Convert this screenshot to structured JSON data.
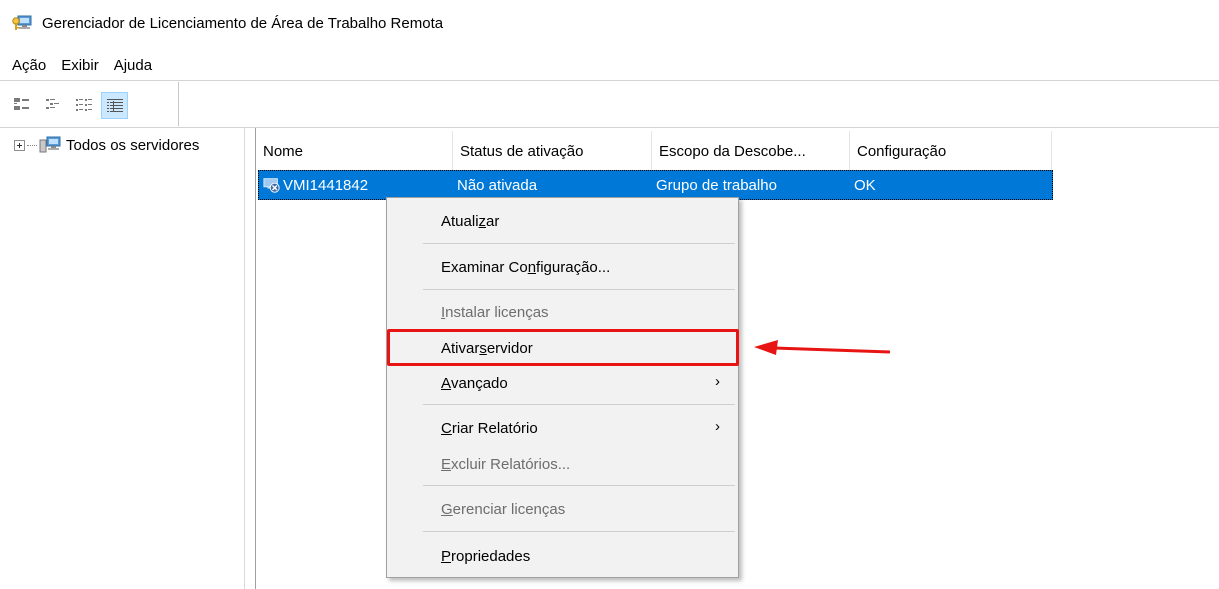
{
  "window": {
    "title": "Gerenciador de Licenciamento de Área de Trabalho Remota",
    "icon": "rd-licensing-icon"
  },
  "menubar": {
    "items": [
      "Ação",
      "Exibir",
      "Ajuda"
    ]
  },
  "toolbar": {
    "buttons": [
      "large-icons-icon",
      "small-icons-icon",
      "list-view-icon",
      "details-view-icon"
    ],
    "active": "details-view-icon"
  },
  "tree": {
    "root_label": "Todos os servidores"
  },
  "list": {
    "columns": [
      "Nome",
      "Status de ativação",
      "Escopo da Descobe...",
      "Configuração"
    ],
    "rows": [
      {
        "name": "VMI1441842",
        "status": "Não ativada",
        "scope": "Grupo de trabalho",
        "config": "OK"
      }
    ]
  },
  "context_menu": {
    "refresh": {
      "pre": "Atuali",
      "key": "z",
      "post": "ar"
    },
    "review": {
      "pre": "Examinar Co",
      "key": "n",
      "post": "figuração..."
    },
    "install": {
      "pre": "",
      "key": "I",
      "post": "nstalar licenças"
    },
    "activate": {
      "pre": "Ativar ",
      "key": "s",
      "post": "ervidor"
    },
    "advanced": {
      "pre": "",
      "key": "A",
      "post": "vançado"
    },
    "create_report": {
      "pre": "",
      "key": "C",
      "post": "riar Relatório"
    },
    "delete_reports": {
      "pre": "",
      "key": "E",
      "post": "xcluir Relatórios..."
    },
    "manage": {
      "pre": "",
      "key": "G",
      "post": "erenciar licenças"
    },
    "properties": {
      "pre": "",
      "key": "P",
      "post": "ropriedades"
    },
    "submenu_arrow": "›"
  },
  "colors": {
    "selection": "#0078d7",
    "annotation": "#e81313",
    "menu_bg": "#f2f2f2"
  }
}
